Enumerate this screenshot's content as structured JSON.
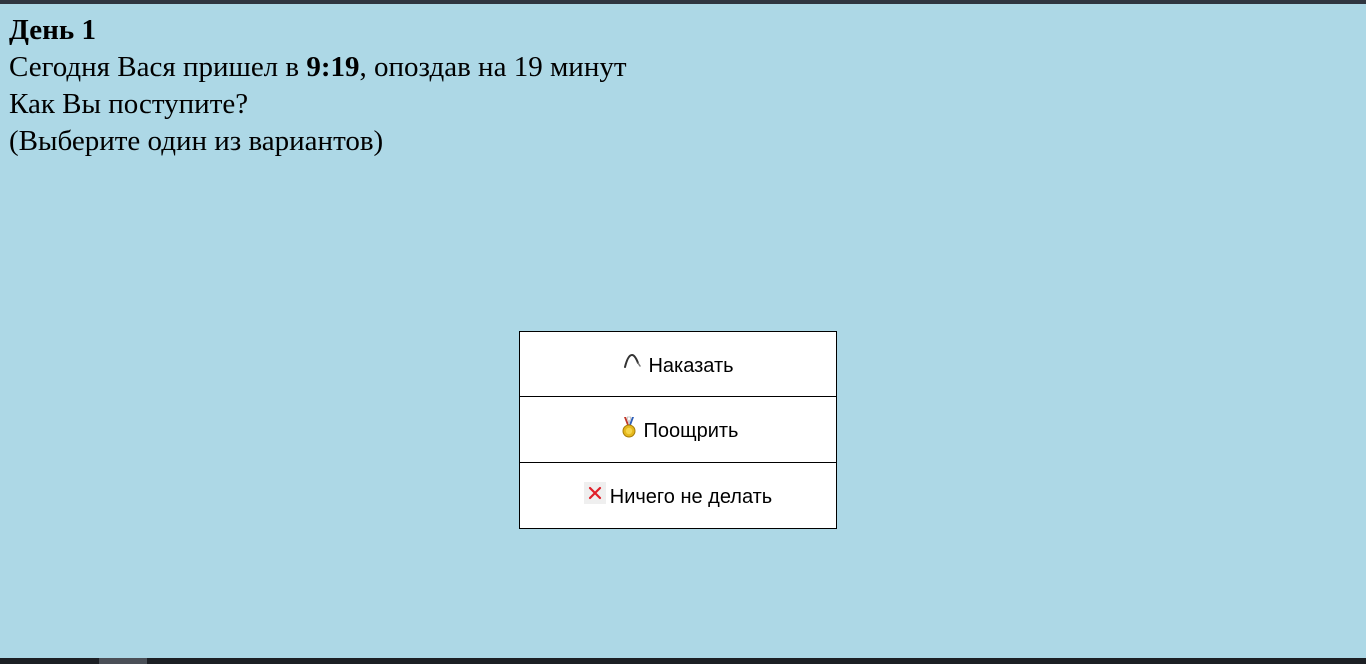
{
  "scenario": {
    "day_title": "День 1",
    "arrival_prefix": "Сегодня Вася пришел в ",
    "arrival_time": "9:19",
    "arrival_suffix": ", опоздав на 19 минут",
    "question": "Как Вы поступите?",
    "hint": "(Выберите один из вариантов)"
  },
  "options": [
    {
      "label": "Наказать",
      "icon": "whip-icon"
    },
    {
      "label": "Поощрить",
      "icon": "medal-icon"
    },
    {
      "label": "Ничего не делать",
      "icon": "cross-icon"
    }
  ],
  "colors": {
    "background": "#add8e6",
    "button_bg": "#ffffff",
    "cross_red": "#e0202a"
  }
}
